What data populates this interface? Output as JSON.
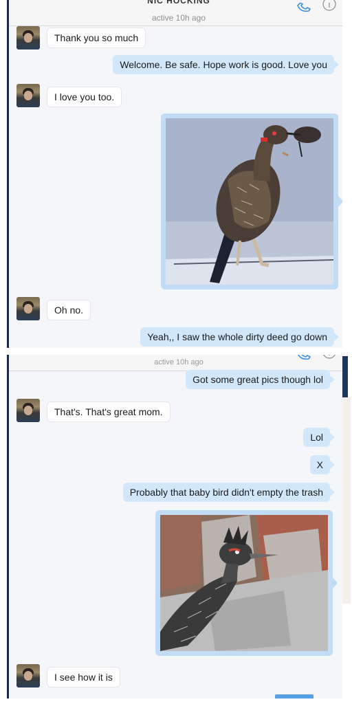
{
  "screens": [
    {
      "header": {
        "title": "NIC HOCKING",
        "status": "active 10h ago"
      },
      "messages": [
        {
          "from": "them",
          "text": "Thank you so much"
        },
        {
          "from": "me",
          "text": "Welcome. Be safe. Hope work is good.  Love you"
        },
        {
          "from": "them",
          "text": "I love you too."
        },
        {
          "from": "me",
          "type": "photo",
          "subject": "roadrunner holding a small bird in its beak"
        },
        {
          "from": "them",
          "text": "Oh no."
        },
        {
          "from": "me",
          "text": "Yeah,, I saw the whole dirty deed go down"
        }
      ]
    },
    {
      "header": {
        "status": "active 10h ago"
      },
      "messages": [
        {
          "from": "me",
          "text": "Got some great pics though lol"
        },
        {
          "from": "them",
          "text": "That's. That's great mom."
        },
        {
          "from": "me",
          "text": "Lol"
        },
        {
          "from": "me",
          "text": "X"
        },
        {
          "from": "me",
          "text": "Probably that baby bird didn't empty the trash"
        },
        {
          "from": "me",
          "type": "photo",
          "subject": "roadrunner standing beside stone blocks"
        },
        {
          "from": "them",
          "text": "I see how it is"
        }
      ]
    }
  ],
  "icons": {
    "call": "phone-icon",
    "info": "info-icon"
  },
  "colors": {
    "outgoing_bubble": "#d3e7fb",
    "incoming_bubble": "#ffffff",
    "background": "#f5f6f9"
  }
}
